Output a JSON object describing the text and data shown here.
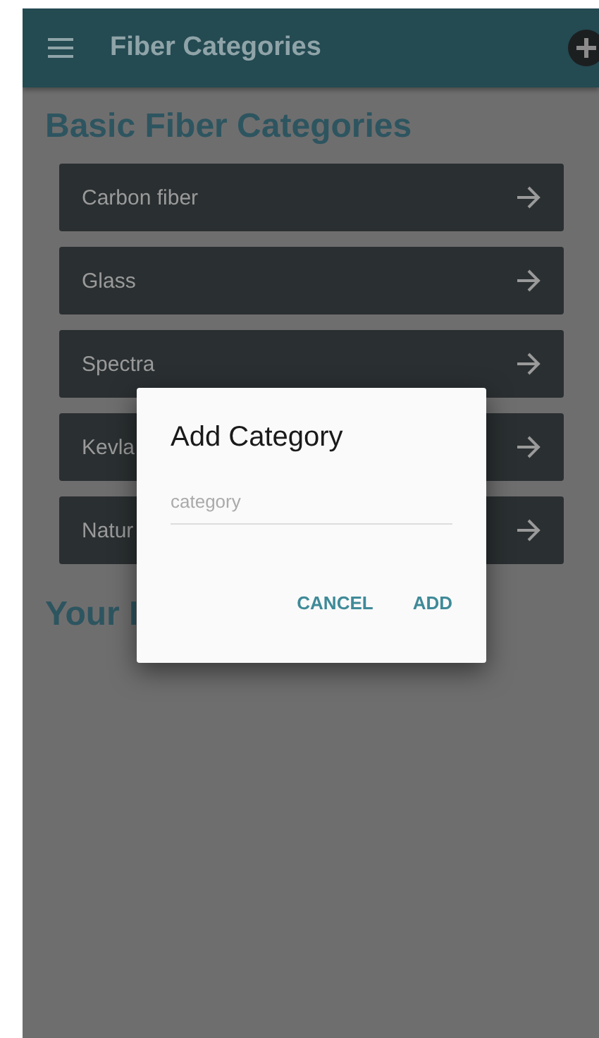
{
  "app_bar": {
    "title": "Fiber Categories"
  },
  "basic_section": {
    "heading": "Basic Fiber Categories",
    "items": [
      {
        "label": "Carbon fiber"
      },
      {
        "label": "Glass"
      },
      {
        "label": "Spectra"
      },
      {
        "label": "Kevla"
      },
      {
        "label": "Natur"
      }
    ]
  },
  "your_section": {
    "heading": "Your I"
  },
  "dialog": {
    "title": "Add Category",
    "field": {
      "placeholder": "category"
    },
    "buttons": [
      "CANCEL",
      "ADD"
    ]
  }
}
